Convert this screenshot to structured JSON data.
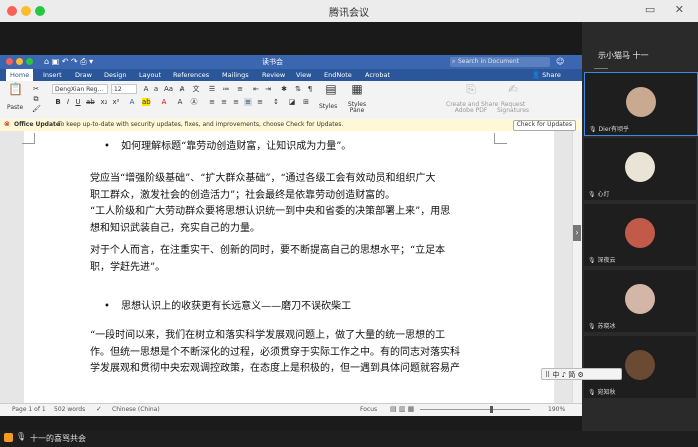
{
  "meeting": {
    "title": "腾讯会议",
    "bottom_name": "十一的喜骂共会"
  },
  "word": {
    "doc_title": "读书会",
    "search_placeholder": "Search in Document",
    "share_label": "Share",
    "tabs": [
      "Home",
      "Insert",
      "Draw",
      "Design",
      "Layout",
      "References",
      "Mailings",
      "Review",
      "View",
      "EndNote",
      "Acrobat"
    ],
    "font_name": "DengXian Reg...",
    "font_size": "12",
    "styles_label": "Styles",
    "styles_pane_label": "Styles\nPane",
    "create_pdf_label": "Create and Share\nAdobe PDF",
    "request_signatures_label": "Request\nSignatures",
    "paste_label": "Paste",
    "update_message_bold": "Office Update",
    "update_message": "To keep up-to-date with security updates, fixes, and improvements, choose Check for Updates.",
    "update_button": "Check for Updates",
    "status_page": "Page 1 of 1",
    "status_words": "502 words",
    "status_lang": "Chinese (China)",
    "status_focus": "Focus",
    "status_zoom": "190%"
  },
  "document": {
    "bullet1": "如何理解标题“靠劳动创造财富，让知识成为力量”。",
    "para1_line1": "党应当“增强阶级基础”、“扩大群众基础”，“通过各级工会有效动员和组织广大",
    "para1_line2": "职工群众，激发社会的创造活力”；社会最终是依靠劳动创造财富的。",
    "para1_line3": "“工人阶级和广大劳动群众要将思想认识统一到中央和省委的决策部署上来”，用思",
    "para1_line4": "想和知识武装自己，充实自己的力量。",
    "para2_line1": "对于个人而言，在注重实干、创新的同时，要不断提高自己的思想水平；“立足本",
    "para2_line2": "职，学赶先进”。",
    "bullet2": "思想认识上的收获更有长远意义——磨刀不误砍柴工",
    "para3_line1": "“一段时间以来，我们在树立和落实科学发展观问题上，做了大量的统一思想的工",
    "para3_line2": "作。但统一思想是个不断深化的过程，必须贯穿于实际工作之中。有的同志对落实科",
    "para3_line3": "学发展观和贯彻中央宏观调控政策，在态度上是积极的，但一遇到具体问题就容易产"
  },
  "participants": [
    {
      "name": "Dier有顷乎",
      "avatar_color": "#c9a98f"
    },
    {
      "name": "心灯",
      "avatar_color": "#e9e4d6"
    },
    {
      "name": "深夜云",
      "avatar_color": "#c25a4a"
    },
    {
      "name": "苏晓冰",
      "avatar_color": "#d4b6a8"
    },
    {
      "name": "宛知秋",
      "avatar_color": "#6a4a32"
    }
  ],
  "panel_header": "示小猫马 十一",
  "float_toolbar": "中 ♪ 简 ⚙",
  "colors": {
    "word_blue": "#2b579a",
    "status_active": "#3b8ae6"
  }
}
